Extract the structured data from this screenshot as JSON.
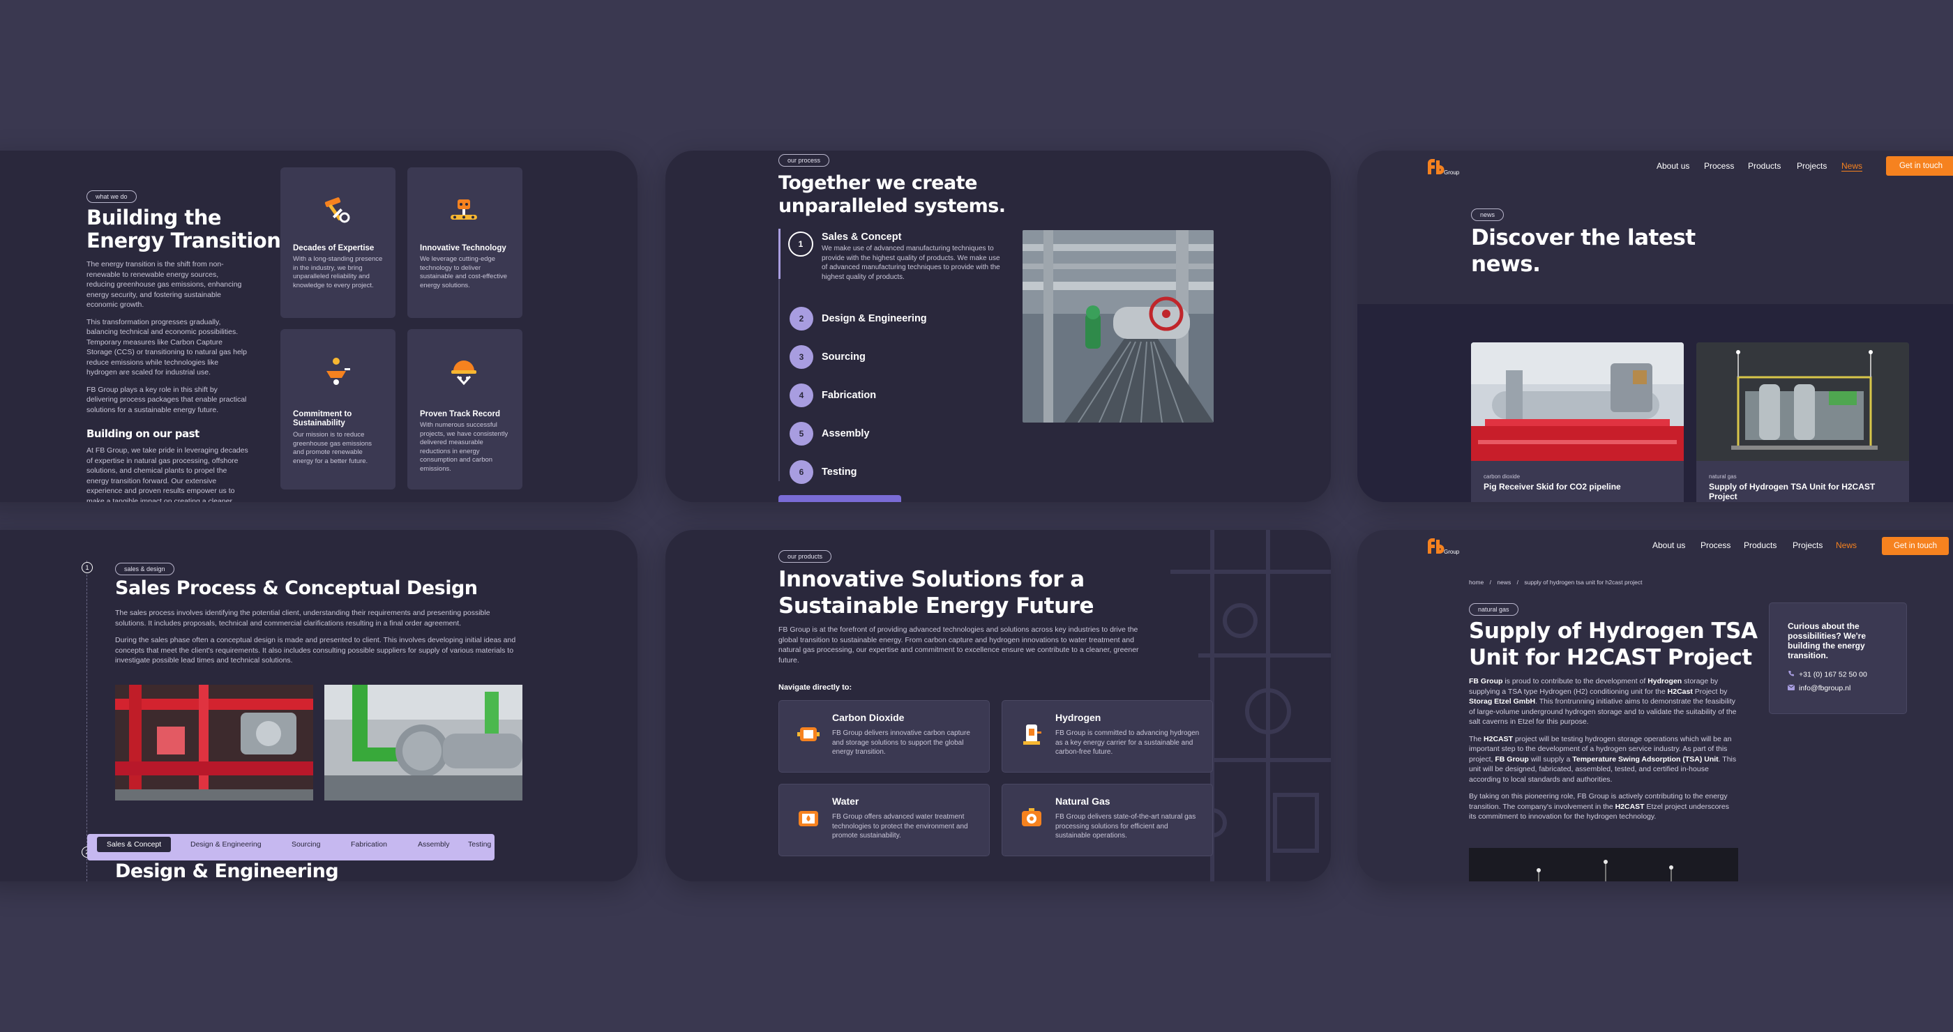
{
  "colors": {
    "background": "#3a3850",
    "card": "#2a283c",
    "accent_purple": "#a89de0",
    "accent_orange": "#f6821f",
    "tile": "#3b3952"
  },
  "about": {
    "tag": "what we do",
    "title_line1": "Building the",
    "title_line2": "Energy Transition",
    "para1": "The energy transition is the shift from non-renewable to renewable energy sources, reducing greenhouse gas emissions, enhancing energy security, and fostering sustainable economic growth.",
    "para2": "This transformation progresses gradually, balancing technical and economic possibilities. Temporary measures like Carbon Capture Storage (CCS) or transitioning to natural gas help reduce emissions while technologies like hydrogen are scaled for industrial use.",
    "para3": "FB Group plays a key role in this shift by delivering process packages that enable practical solutions for a sustainable energy future.",
    "subtitle": "Building on our past",
    "para4": "At FB Group, we take pride in leveraging decades of expertise in natural gas processing, offshore solutions, and chemical plants to propel the energy transition forward. Our extensive experience and proven results empower us to make a tangible impact on creating a cleaner, more sustainable future.",
    "features": [
      {
        "icon": "tools-icon",
        "title": "Decades of Expertise",
        "desc": "With a long-standing presence in the industry, we bring unparalleled reliability and knowledge to every project."
      },
      {
        "icon": "conveyor-robot-icon",
        "title": "Innovative Technology",
        "desc": "We leverage cutting-edge technology to deliver sustainable and cost-effective energy solutions."
      },
      {
        "icon": "wheelbarrow-icon",
        "title": "Commitment to Sustainability",
        "desc": "Our mission is to reduce greenhouse gas emissions and promote renewable energy for a better future."
      },
      {
        "icon": "hard-hat-worker-icon",
        "title": "Proven Track Record",
        "desc": "With numerous successful projects, we have consistently delivered measurable reductions in energy consumption and carbon emissions."
      }
    ]
  },
  "process": {
    "tag": "our process",
    "title_line1": "Together we create",
    "title_line2": "unparalleled systems.",
    "steps": [
      {
        "num": "1",
        "label": "Sales & Concept",
        "desc": "We make use of advanced manufacturing techniques to provide with the highest quality of products. We make use of advanced manufacturing techniques to provide with the highest quality of products."
      },
      {
        "num": "2",
        "label": "Design & Engineering"
      },
      {
        "num": "3",
        "label": "Sourcing"
      },
      {
        "num": "4",
        "label": "Fabrication"
      },
      {
        "num": "5",
        "label": "Assembly"
      },
      {
        "num": "6",
        "label": "Testing"
      }
    ]
  },
  "news": {
    "logo_text": "Group",
    "nav": [
      "About us",
      "Process",
      "Products",
      "Projects",
      "News"
    ],
    "cta": "Get in touch",
    "tag": "news",
    "title_line1": "Discover the latest",
    "title_line2": "news.",
    "cards": [
      {
        "category": "carbon dioxide",
        "title": "Pig Receiver Skid for CO2 pipeline"
      },
      {
        "category": "natural gas",
        "title": "Supply of Hydrogen TSA Unit for H2CAST Project"
      }
    ]
  },
  "sales": {
    "step_num": "1",
    "step2_num": "2",
    "tag": "sales & design",
    "title": "Sales Process & Conceptual Design",
    "para1": "The sales process involves identifying the potential client, understanding their requirements and presenting possible solutions. It includes proposals, technical and commercial clarifications resulting in a final order agreement.",
    "para2": "During the sales phase often a conceptual design is made and presented to client. This involves developing initial ideas and concepts that meet the client's requirements. It also includes consulting possible suppliers for supply of various materials to investigate possible lead times and technical solutions.",
    "tabs": [
      "Sales & Concept",
      "Design & Engineering",
      "Sourcing",
      "Fabrication",
      "Assembly",
      "Testing"
    ],
    "next_title": "Design & Engineering"
  },
  "products": {
    "tag": "our products",
    "title_line1": "Innovative Solutions for a",
    "title_line2": "Sustainable Energy Future",
    "intro": "FB Group is at the forefront of providing advanced technologies and solutions across key industries to drive the global transition to sustainable energy. From carbon capture and hydrogen innovations to water treatment and natural gas processing, our expertise and commitment to excellence ensure we contribute to a cleaner, greener future.",
    "navigate_label": "Navigate directly to:",
    "solutions": [
      {
        "icon": "co2-unit-icon",
        "title": "Carbon Dioxide",
        "desc": "FB Group delivers innovative carbon capture and storage solutions to support the global energy transition."
      },
      {
        "icon": "hydrogen-unit-icon",
        "title": "Hydrogen",
        "desc": "FB Group is committed to advancing hydrogen as a key energy carrier for a sustainable and carbon-free future."
      },
      {
        "icon": "water-unit-icon",
        "title": "Water",
        "desc": "FB Group offers advanced water treatment technologies to protect the environment and promote sustainability."
      },
      {
        "icon": "gas-unit-icon",
        "title": "Natural Gas",
        "desc": "FB Group delivers state-of-the-art natural gas processing solutions for efficient and sustainable operations."
      }
    ]
  },
  "article": {
    "logo_text": "Group",
    "nav": [
      "About us",
      "Process",
      "Products",
      "Projects",
      "News"
    ],
    "cta": "Get in touch",
    "breadcrumb": [
      "home",
      "news",
      "supply of hydrogen tsa unit for h2cast project"
    ],
    "breadcrumb_sep": "/",
    "tag": "natural gas",
    "title_line1": "Supply of Hydrogen TSA",
    "title_line2": "Unit for H2CAST Project",
    "p1": {
      "a": "FB Group",
      "b": " is proud to contribute to the development of ",
      "c": "Hydrogen",
      "d": " storage by supplying a TSA type Hydrogen (H2) conditioning unit for the ",
      "e": "H2Cast",
      "f": " Project by ",
      "g": "Storag Etzel GmbH",
      "h": ". This frontrunning initiative aims to demonstrate the feasibility of large-volume underground hydrogen storage and to validate the suitability of the salt caverns in Etzel for this purpose."
    },
    "p2": {
      "a": "The ",
      "b": "H2CAST",
      "c": " project will be testing hydrogen storage operations which will be an important step to the development of a hydrogen service industry. As part of this project, ",
      "d": "FB Group",
      "e": " will supply a ",
      "f": "Temperature Swing Adsorption (TSA) Unit",
      "g": ". This unit will be designed, fabricated, assembled, tested, and certified in-house according to local standards and authorities."
    },
    "p3": {
      "a": "By taking on this pioneering role, FB Group is actively contributing to the energy transition. The company's involvement in the ",
      "b": "H2CAST",
      "c": " Etzel project underscores its commitment to innovation for the hydrogen technology."
    },
    "contact": {
      "title": "Curious about the possibilities? We're building the energy transition.",
      "phone": "+31 (0) 167 52 50 00",
      "email": "info@fbgroup.nl"
    }
  }
}
